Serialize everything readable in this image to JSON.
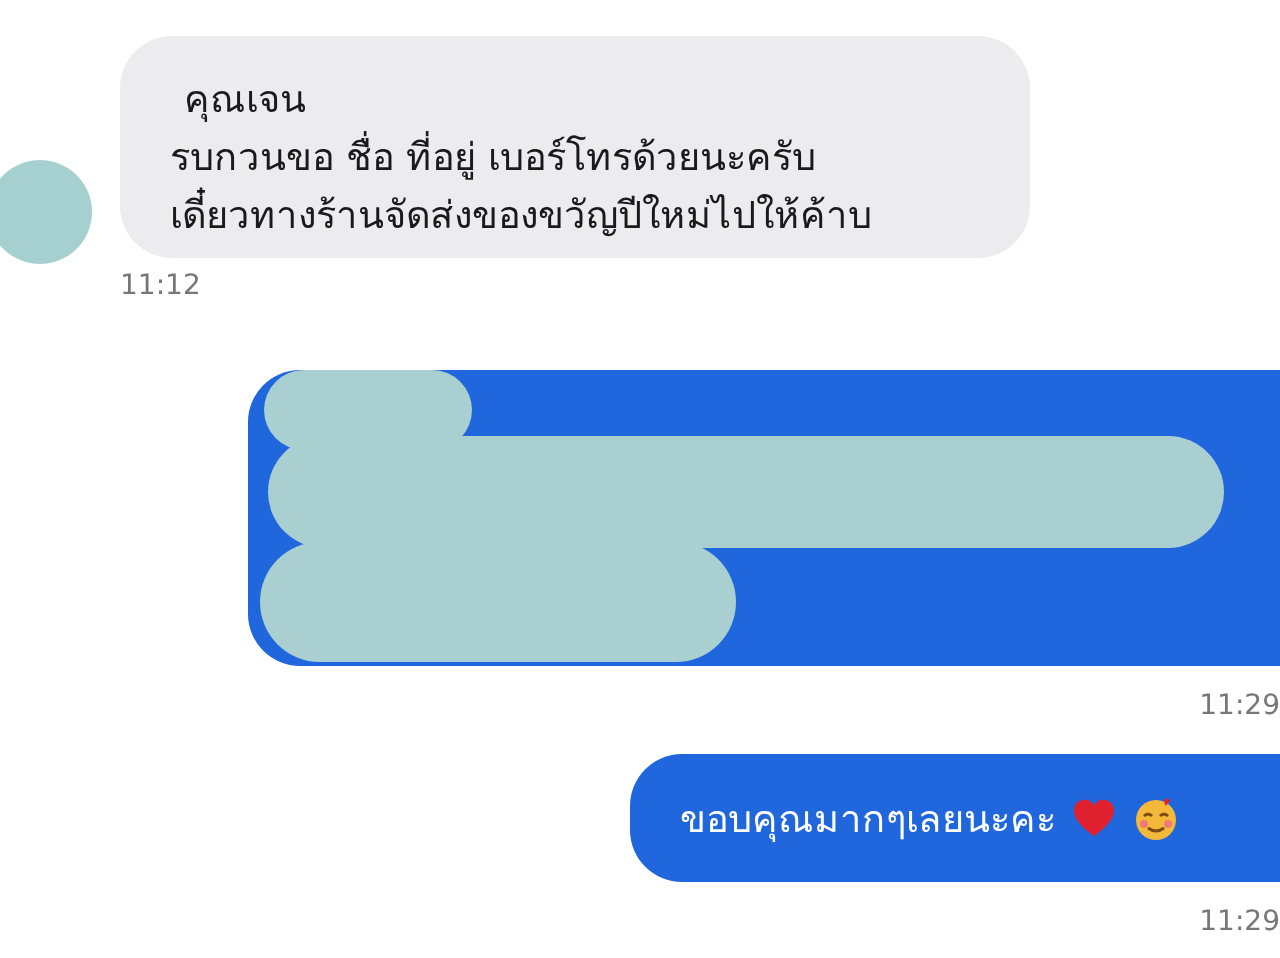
{
  "messages": [
    {
      "kind": "incoming",
      "lines": [
        "คุณเจน",
        "รบกวนขอ ชื่อ ที่อยู่ เบอร์โทรด้วยนะครับ",
        "เดี๋ยวทางร้านจัดส่งของขวัญปีใหม่ไปให้ค้าบ"
      ],
      "time": "11:12"
    },
    {
      "kind": "redacted",
      "time": "11:29"
    },
    {
      "kind": "outgoing",
      "text": "ขอบคุณมากๆเลยนะคะ",
      "time": "11:29"
    }
  ]
}
